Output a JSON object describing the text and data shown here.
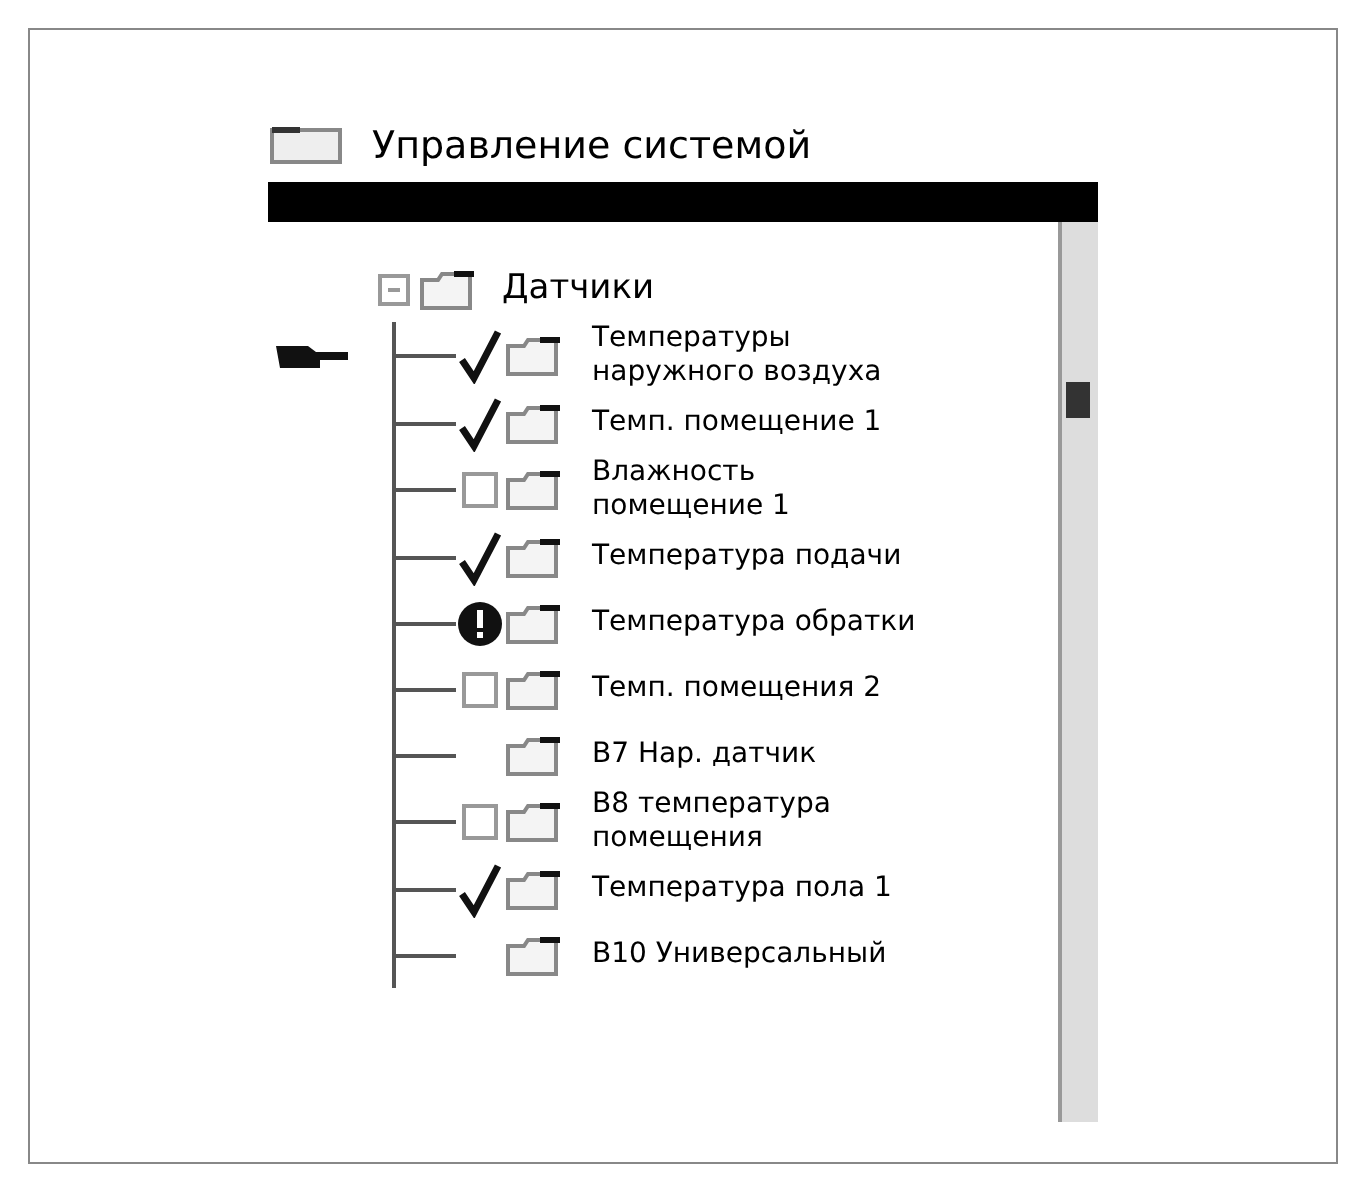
{
  "title": "Управление системой",
  "tree": {
    "label": "Датчики",
    "expanded": true,
    "children": [
      {
        "label": "Температуры\nнаружного воздуха",
        "kind": "checked",
        "selected": true
      },
      {
        "label": "Темп. помещение 1",
        "kind": "checked",
        "selected": false
      },
      {
        "label": "Влажность\nпомещение 1",
        "kind": "unchecked",
        "selected": false
      },
      {
        "label": "Температура подачи",
        "kind": "checked",
        "selected": false
      },
      {
        "label": "Температура обратки",
        "kind": "alarm",
        "selected": false
      },
      {
        "label": "Темп. помещения 2",
        "kind": "unchecked",
        "selected": false
      },
      {
        "label": "B7 Нар. датчик",
        "kind": "plain",
        "selected": false
      },
      {
        "label": "B8 температура\nпомещения",
        "kind": "unchecked",
        "selected": false
      },
      {
        "label": "Температура пола 1",
        "kind": "checked",
        "selected": false
      },
      {
        "label": "B10 Универсальный",
        "kind": "plain",
        "selected": false
      }
    ]
  }
}
